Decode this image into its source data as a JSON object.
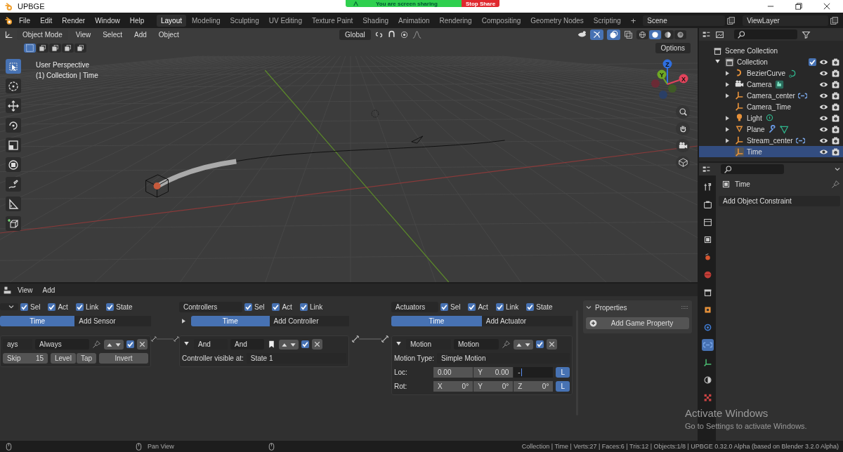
{
  "window": {
    "title": "UPBGE"
  },
  "screen_share": {
    "message": "You are screen sharing",
    "stop": "Stop Share"
  },
  "menu": [
    "File",
    "Edit",
    "Render",
    "Window",
    "Help"
  ],
  "workspaces": [
    {
      "label": "Layout",
      "selected": true
    },
    {
      "label": "Modeling",
      "selected": false
    },
    {
      "label": "Sculpting",
      "selected": false
    },
    {
      "label": "UV Editing",
      "selected": false
    },
    {
      "label": "Texture Paint",
      "selected": false
    },
    {
      "label": "Shading",
      "selected": false
    },
    {
      "label": "Animation",
      "selected": false
    },
    {
      "label": "Rendering",
      "selected": false
    },
    {
      "label": "Compositing",
      "selected": false
    },
    {
      "label": "Geometry Nodes",
      "selected": false
    },
    {
      "label": "Scripting",
      "selected": false
    }
  ],
  "add_workspace": "+",
  "scene": "Scene",
  "view_layer": "ViewLayer",
  "viewport": {
    "mode": "Object Mode",
    "menus": [
      "View",
      "Select",
      "Add",
      "Object"
    ],
    "orientation": "Global",
    "gizmos": true,
    "overlays": true,
    "shading_modes": [
      {
        "selected": false
      },
      {
        "selected": true
      },
      {
        "selected": false
      },
      {
        "selected": false
      }
    ],
    "select_modes": [
      {
        "selected": true
      },
      {
        "selected": false
      },
      {
        "selected": false
      },
      {
        "selected": false
      },
      {
        "selected": false
      }
    ],
    "perspective": "User Perspective",
    "context": "(1) Collection | Time",
    "options": "Options",
    "tools": [
      {
        "kind": "select",
        "selected": true
      },
      {
        "kind": "cursor",
        "selected": false
      },
      {
        "kind": "move",
        "selected": false
      },
      {
        "kind": "rotate",
        "selected": false
      },
      {
        "kind": "scale",
        "selected": false
      },
      {
        "kind": "transform",
        "selected": false
      },
      {
        "kind": "annotate",
        "selected": false
      },
      {
        "kind": "measure",
        "selected": false
      },
      {
        "kind": "add_cube",
        "selected": false
      }
    ],
    "gizmo_axes": [
      {
        "label": "Z",
        "color": "#2f6fe0"
      },
      {
        "label": "Y",
        "color": "#6ea824"
      },
      {
        "label": "X",
        "color": "#e2435b"
      }
    ]
  },
  "outliner": {
    "root": "Scene Collection",
    "collection": {
      "label": "Collection",
      "expanded": true,
      "checked": true
    },
    "items": [
      {
        "name": "BezierCurve",
        "kind": "curve",
        "expandable": true,
        "extras": [
          {
            "kind": "curve_data"
          }
        ],
        "selected": false
      },
      {
        "name": "Camera",
        "kind": "camera",
        "expandable": true,
        "extras": [
          {
            "kind": "camera_data"
          }
        ],
        "selected": false
      },
      {
        "name": "Camera_center",
        "kind": "empty",
        "expandable": true,
        "extras": [
          {
            "kind": "constraint"
          }
        ],
        "selected": false
      },
      {
        "name": "Camera_Time",
        "kind": "empty",
        "expandable": false,
        "selected": false
      },
      {
        "name": "Light",
        "kind": "light",
        "expandable": true,
        "extras": [
          {
            "kind": "light_data"
          }
        ],
        "selected": false
      },
      {
        "name": "Plane",
        "kind": "mesh",
        "expandable": true,
        "extras": [
          {
            "kind": "modifier"
          },
          {
            "kind": "mesh_data"
          }
        ],
        "selected": false
      },
      {
        "name": "Stream_center",
        "kind": "empty",
        "expandable": true,
        "extras": [
          {
            "kind": "constraint"
          }
        ],
        "selected": false
      },
      {
        "name": "Time",
        "kind": "empty",
        "expandable": false,
        "selected": true
      }
    ]
  },
  "properties": {
    "tabs": [
      {
        "kind": "tool",
        "selected": false
      },
      {
        "kind": "render",
        "selected": false
      },
      {
        "kind": "output",
        "selected": false
      },
      {
        "kind": "view_layer",
        "selected": false
      },
      {
        "kind": "scene",
        "selected": false
      },
      {
        "kind": "world",
        "selected": false
      },
      {
        "kind": "collection",
        "selected": false
      },
      {
        "kind": "object",
        "selected": false
      },
      {
        "kind": "physics",
        "selected": false
      },
      {
        "kind": "constraint",
        "selected": true
      },
      {
        "kind": "data",
        "selected": false
      },
      {
        "kind": "shader",
        "selected": false
      },
      {
        "kind": "texture",
        "selected": false
      }
    ],
    "object": "Time",
    "add_constraint": "Add Object Constraint"
  },
  "logic": {
    "menus": [
      "View",
      "Add"
    ],
    "sensors": {
      "filters": [
        {
          "label": "Sel",
          "checked": true
        },
        {
          "label": "Act",
          "checked": true
        },
        {
          "label": "Link",
          "checked": true
        },
        {
          "label": "State",
          "checked": true
        }
      ],
      "object": "Time",
      "add": "Add Sensor",
      "brick": {
        "type": "ays",
        "name": "Always",
        "enabled": true,
        "skip_label": "Skip",
        "skip": "15",
        "toggles": [
          "Level",
          "Tap"
        ],
        "invert": "Invert"
      }
    },
    "controllers": {
      "menu": "Controllers",
      "filters": [
        {
          "label": "Sel",
          "checked": true
        },
        {
          "label": "Act",
          "checked": true
        },
        {
          "label": "Link",
          "checked": true
        }
      ],
      "expanded": false,
      "object": "Time",
      "add": "Add Controller",
      "brick": {
        "expanded": true,
        "type": "And",
        "name": "And",
        "enabled": true,
        "visible_label": "Controller visible at:",
        "state": "State 1"
      }
    },
    "actuators": {
      "menu": "Actuators",
      "filters": [
        {
          "label": "Sel",
          "checked": true
        },
        {
          "label": "Act",
          "checked": true
        },
        {
          "label": "Link",
          "checked": true
        },
        {
          "label": "State",
          "checked": true
        }
      ],
      "object": "Time",
      "add": "Add Actuator",
      "brick": {
        "expanded": true,
        "type": "Motion",
        "name": "Motion",
        "enabled": true,
        "motion_type_label": "Motion Type:",
        "motion_type": "Simple Motion",
        "loc": {
          "label": "Loc:",
          "fields": [
            {
              "value": "0.00",
              "editing": false
            },
            {
              "label": "Y",
              "value": "0.00",
              "editing": false
            },
            {
              "value": "-",
              "editing": true
            }
          ],
          "local": {
            "label": "L",
            "on": true
          }
        },
        "rot": {
          "label": "Rot:",
          "fields": [
            {
              "label": "X",
              "value": "0°",
              "editing": false
            },
            {
              "label": "Y",
              "value": "0°",
              "editing": false
            },
            {
              "label": "Z",
              "value": "0°",
              "editing": false
            }
          ],
          "local": {
            "label": "L",
            "on": true
          }
        }
      }
    },
    "game_properties": {
      "title": "Properties",
      "add": "Add Game Property"
    }
  },
  "status_bar": {
    "hint": "Pan View",
    "stats": "Collection | Time | Verts:27 | Faces:6 | Tris:12 | Objects:1/8 | UPBGE 0.32.0 Alpha (based on Blender 3.2.0 Alpha)"
  },
  "activation": {
    "title": "Activate Windows",
    "text": "Go to Settings to activate Windows."
  }
}
